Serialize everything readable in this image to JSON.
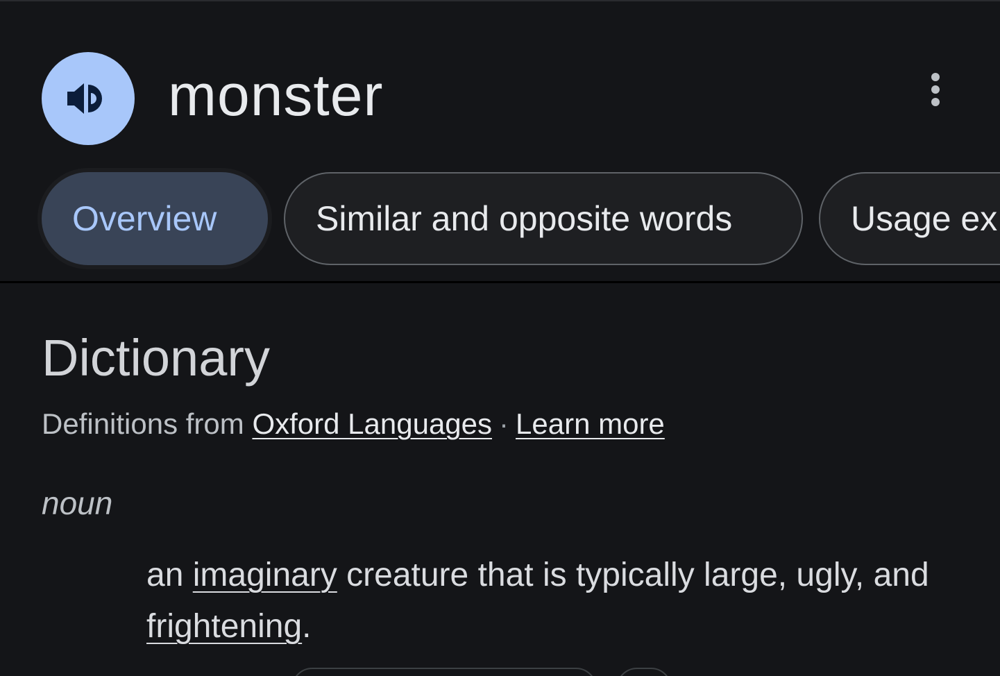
{
  "header": {
    "word": "monster",
    "speaker_icon": "speaker-volume-icon",
    "more_icon": "more-vert-icon"
  },
  "tabs": [
    {
      "label": "Overview",
      "active": true
    },
    {
      "label": "Similar and opposite words",
      "active": false
    },
    {
      "label": "Usage ex",
      "active": false
    }
  ],
  "dictionary": {
    "title": "Dictionary",
    "source_prefix": "Definitions from ",
    "source_link": "Oxford Languages",
    "separator": "·",
    "learn_more": "Learn more",
    "part_of_speech": "noun",
    "definition": {
      "part1": "an ",
      "link1": "imaginary",
      "part2": " creature that is typically large, ugly, and ",
      "link2": "frightening",
      "part3": "."
    }
  },
  "colors": {
    "background": "#141518",
    "accent": "#a8c7fa",
    "active_tab_bg": "#394457",
    "text": "#e8eaed"
  }
}
